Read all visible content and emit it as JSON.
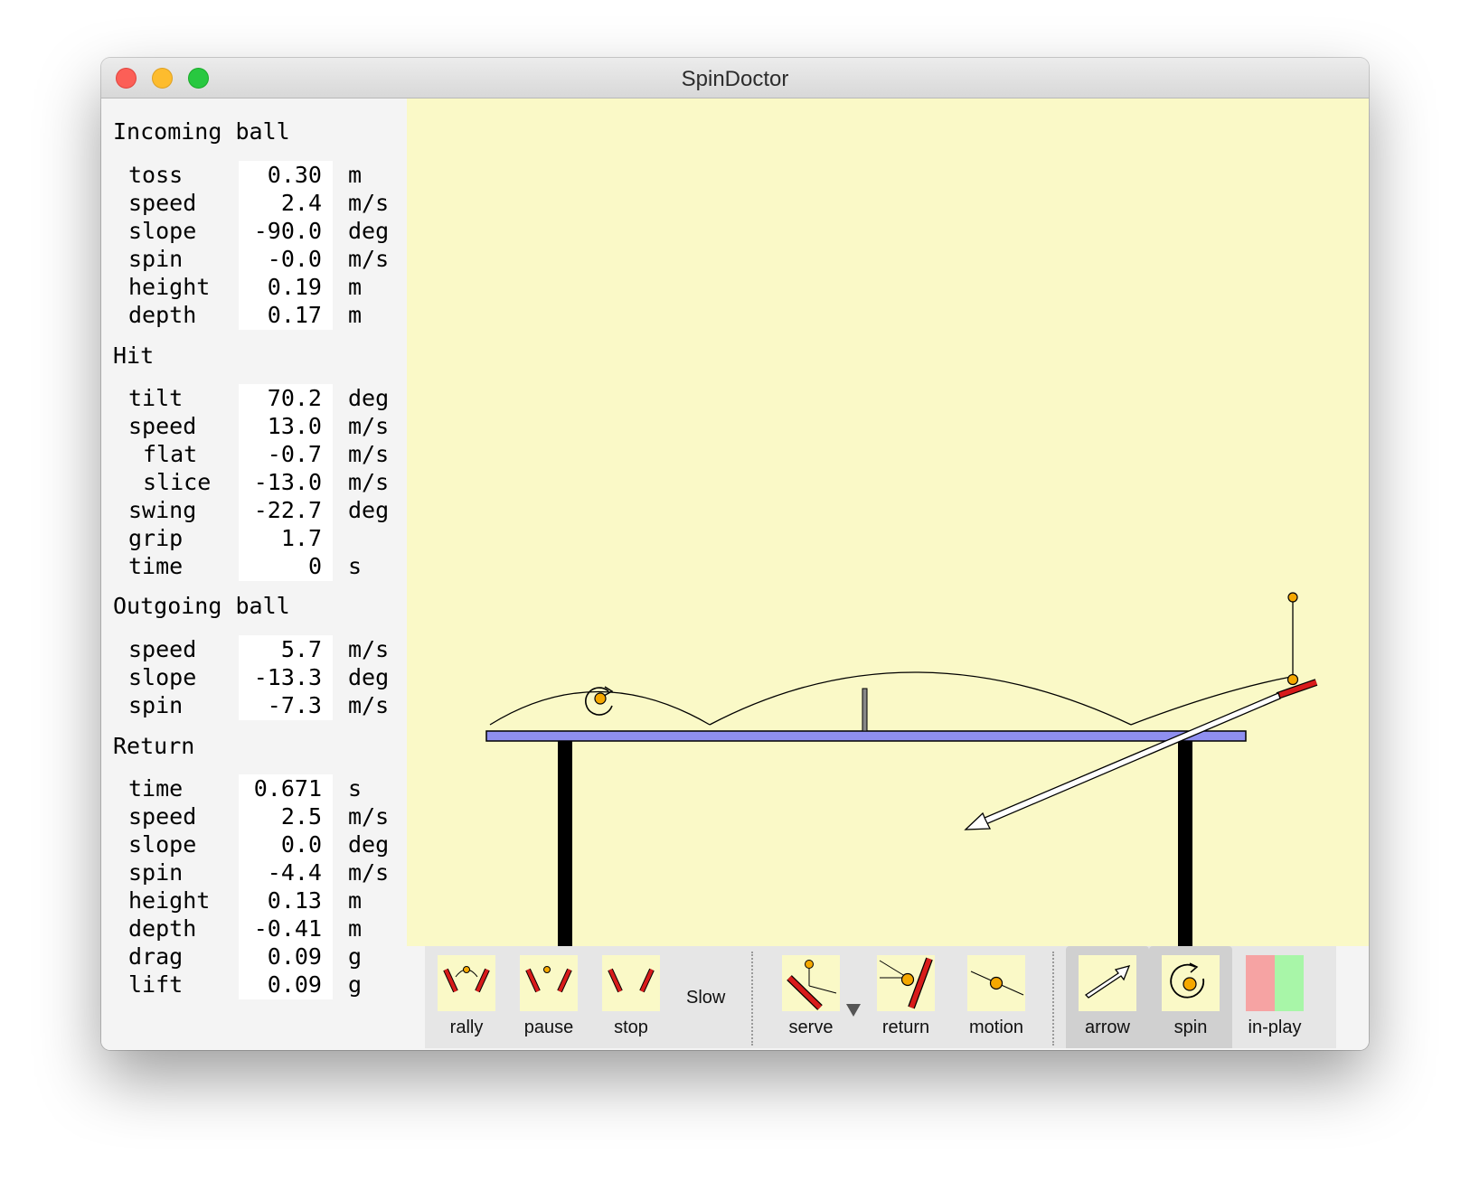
{
  "window": {
    "title": "SpinDoctor"
  },
  "incoming": {
    "title": "Incoming ball",
    "rows": [
      {
        "label": "toss",
        "value": "0.30",
        "unit": "m"
      },
      {
        "label": "speed",
        "value": "2.4",
        "unit": "m/s"
      },
      {
        "label": "slope",
        "value": "-90.0",
        "unit": "deg"
      },
      {
        "label": "spin",
        "value": "-0.0",
        "unit": "m/s"
      },
      {
        "label": "height",
        "value": "0.19",
        "unit": "m"
      },
      {
        "label": "depth",
        "value": "0.17",
        "unit": "m"
      }
    ]
  },
  "hit": {
    "title": "Hit",
    "rows": [
      {
        "label": "tilt",
        "value": "70.2",
        "unit": "deg"
      },
      {
        "label": "speed",
        "value": "13.0",
        "unit": "m/s"
      },
      {
        "label": "flat",
        "value": "-0.7",
        "unit": "m/s"
      },
      {
        "label": "slice",
        "value": "-13.0",
        "unit": "m/s"
      },
      {
        "label": "swing",
        "value": "-22.7",
        "unit": "deg"
      },
      {
        "label": "grip",
        "value": "1.7",
        "unit": ""
      },
      {
        "label": "time",
        "value": "0",
        "unit": "s"
      }
    ]
  },
  "outgoing": {
    "title": "Outgoing ball",
    "rows": [
      {
        "label": "speed",
        "value": "5.7",
        "unit": "m/s"
      },
      {
        "label": "slope",
        "value": "-13.3",
        "unit": "deg"
      },
      {
        "label": "spin",
        "value": "-7.3",
        "unit": "m/s"
      }
    ]
  },
  "ret": {
    "title": "Return",
    "rows": [
      {
        "label": "time",
        "value": "0.671",
        "unit": "s"
      },
      {
        "label": "speed",
        "value": "2.5",
        "unit": "m/s"
      },
      {
        "label": "slope",
        "value": "0.0",
        "unit": "deg"
      },
      {
        "label": "spin",
        "value": "-4.4",
        "unit": "m/s"
      },
      {
        "label": "height",
        "value": "0.13",
        "unit": "m"
      },
      {
        "label": "depth",
        "value": "-0.41",
        "unit": "m"
      },
      {
        "label": "drag",
        "value": "0.09",
        "unit": "g"
      },
      {
        "label": "lift",
        "value": "0.09",
        "unit": "g"
      }
    ]
  },
  "toolbar": {
    "rally": "rally",
    "pause": "pause",
    "stop": "stop",
    "slow": "Slow",
    "serve": "serve",
    "return": "return",
    "motion": "motion",
    "arrow": "arrow",
    "spin": "spin",
    "in_play": "in-play"
  },
  "colors": {
    "canvas_bg": "#faf9c7",
    "table_top": "#8f8ff0",
    "paddle": "#d81b1b",
    "ball": "#f5a800",
    "in_play_red": "#f6a3a3",
    "in_play_green": "#a8f6a8"
  }
}
